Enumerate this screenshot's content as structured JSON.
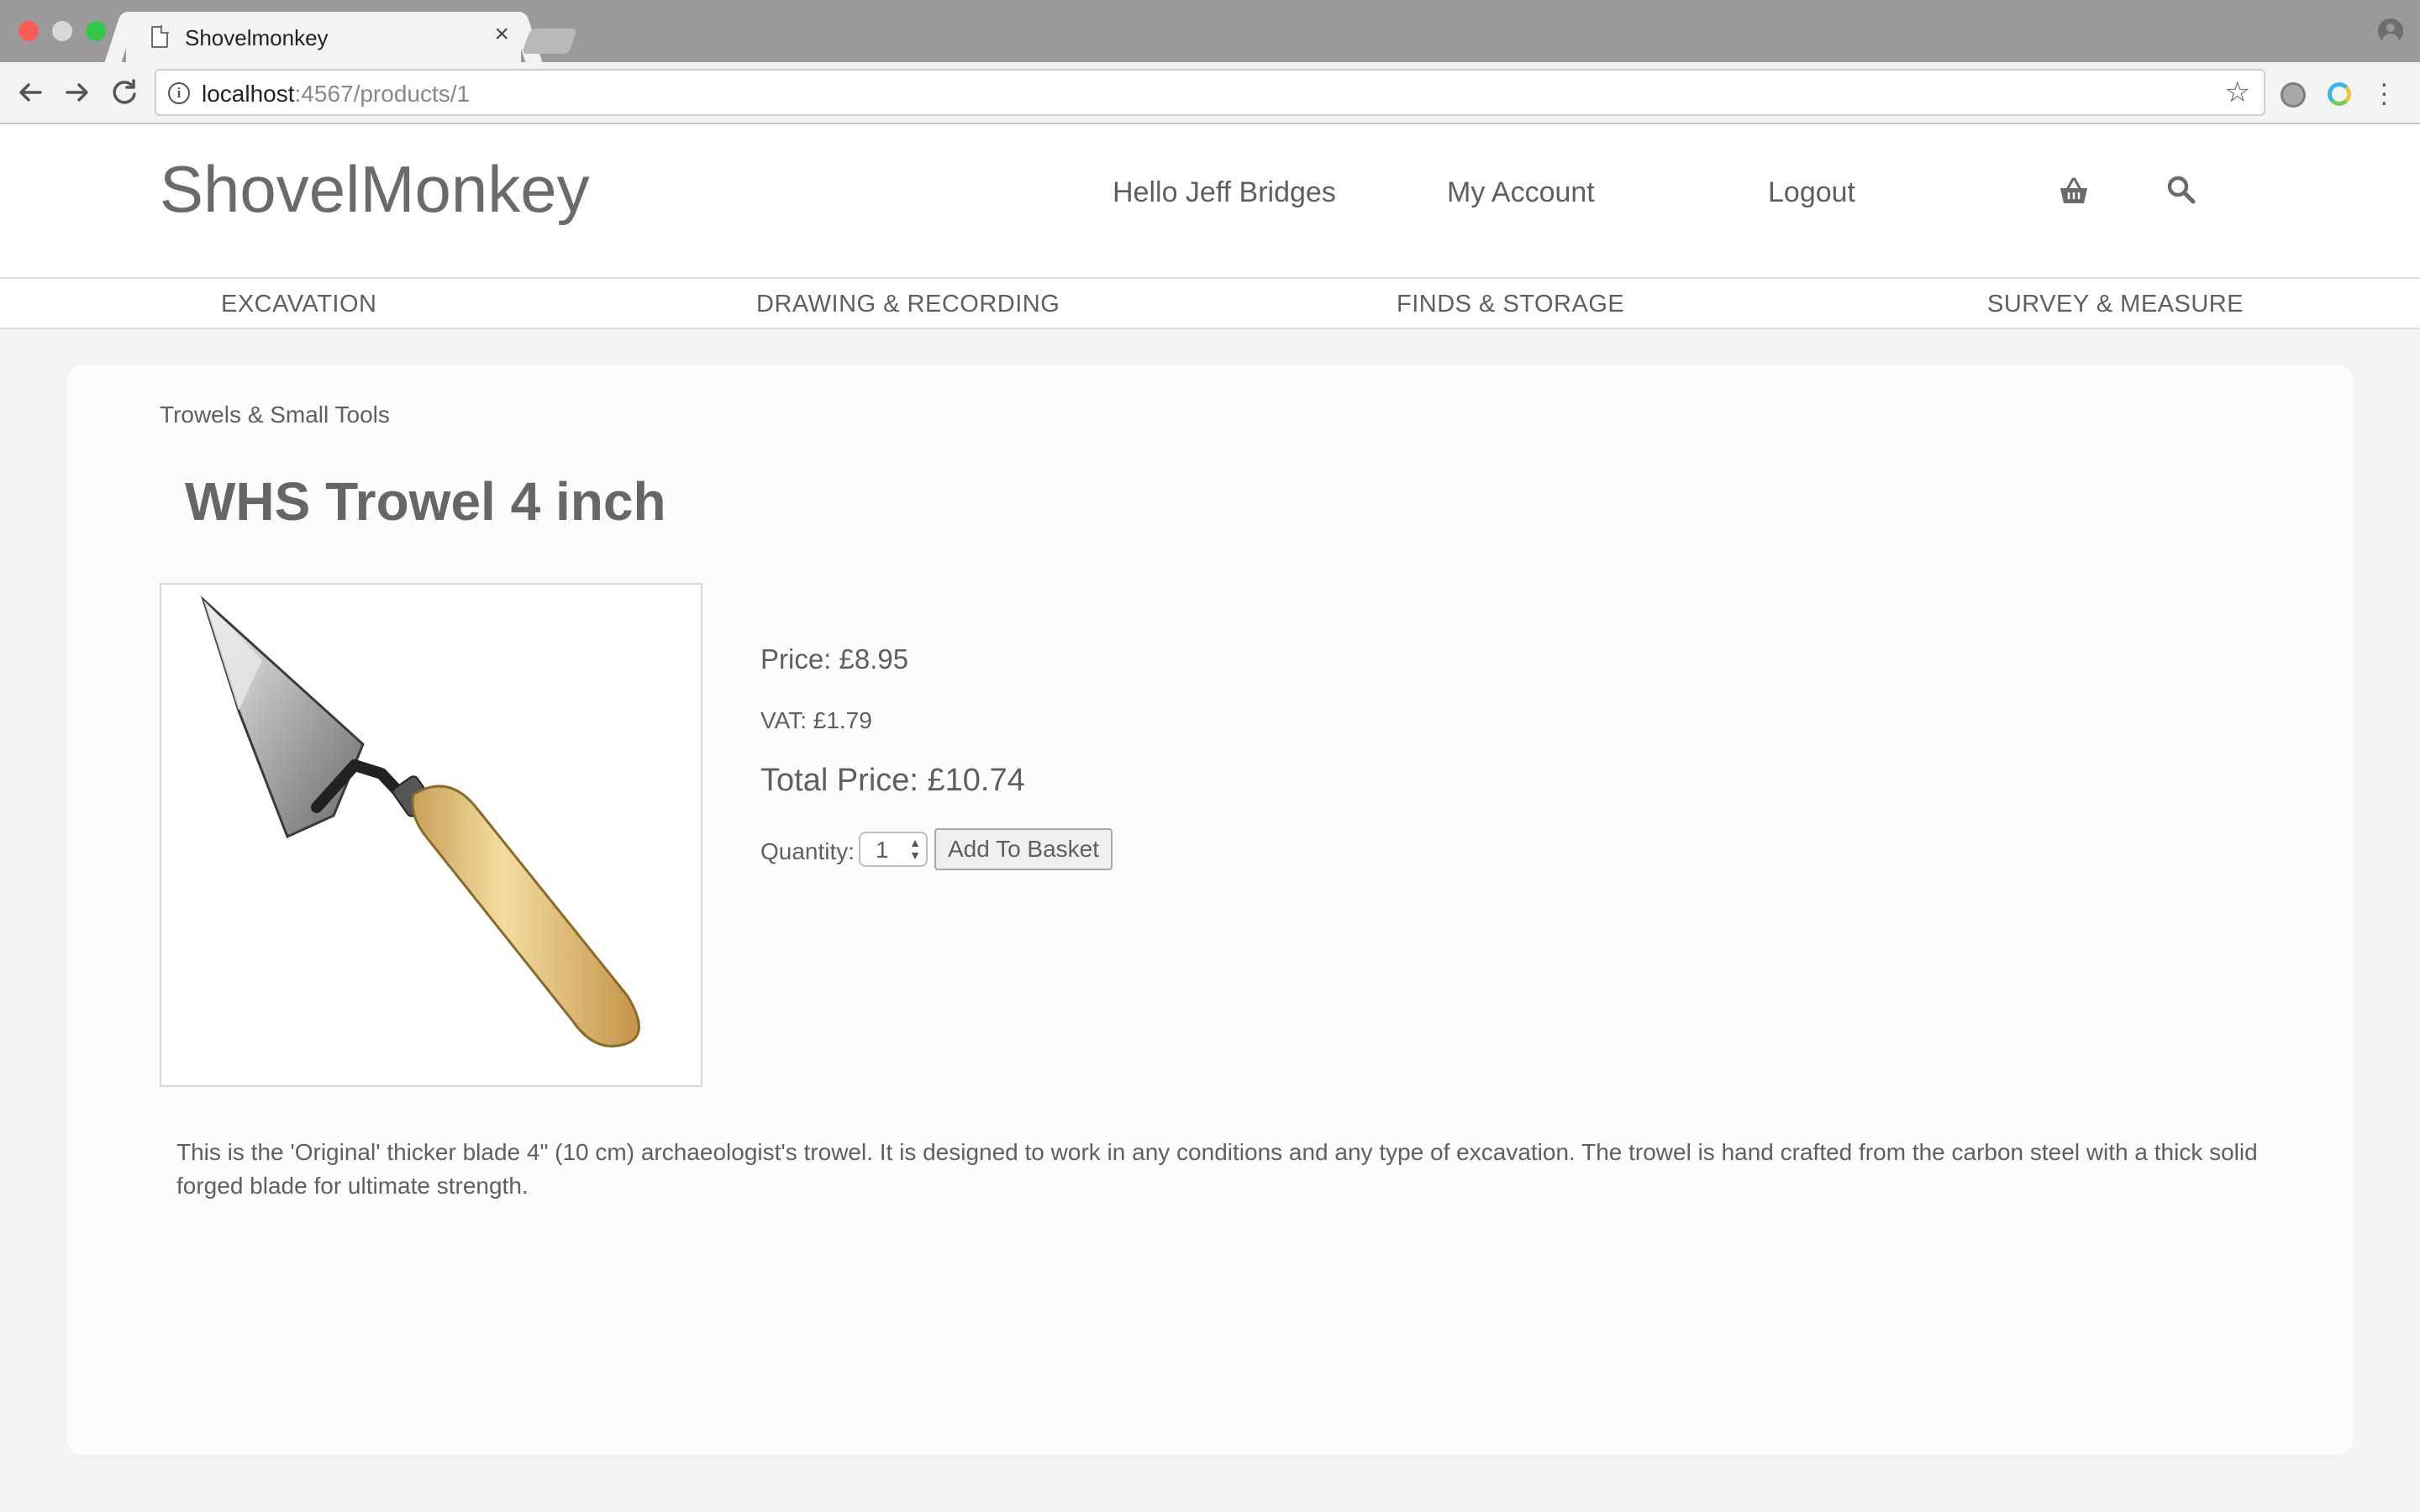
{
  "browser": {
    "tab_title": "Shovelmonkey",
    "tab_close": "×",
    "url_host": "localhost",
    "url_path": ":4567/products/1"
  },
  "header": {
    "logo": "ShovelMonkey",
    "greeting": "Hello Jeff Bridges",
    "my_account": "My Account",
    "logout": "Logout"
  },
  "categories": [
    {
      "label": "EXCAVATION"
    },
    {
      "label": "DRAWING & RECORDING"
    },
    {
      "label": "FINDS & STORAGE"
    },
    {
      "label": "SURVEY & MEASURE"
    }
  ],
  "product": {
    "breadcrumb": "Trowels & Small Tools",
    "title": "WHS Trowel 4 inch",
    "price": "Price: £8.95",
    "vat": "VAT: £1.79",
    "total": "Total Price: £10.74",
    "quantity_label": "Quantity:",
    "quantity_value": "1",
    "add_to_basket": "Add To Basket",
    "description": "This is the 'Original' thicker blade 4\" (10 cm) archaeologist's trowel. It is designed to work in any conditions and any type of excavation. The trowel is hand crafted from the carbon steel with a thick solid forged blade for ultimate strength."
  },
  "icons": {
    "basket": "basket-icon",
    "search": "search-icon",
    "back": "arrow-left-icon",
    "forward": "arrow-right-icon",
    "reload": "reload-icon",
    "bookmark": "star-icon"
  }
}
